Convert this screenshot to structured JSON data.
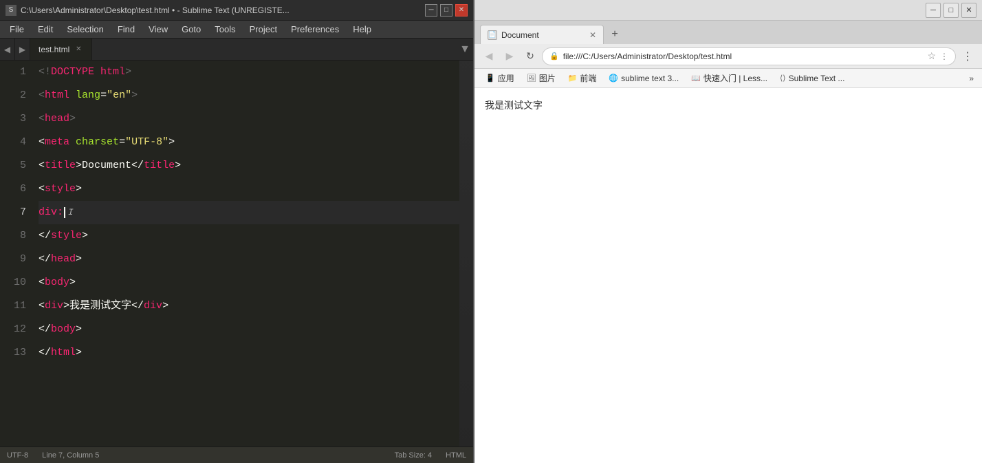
{
  "sublime": {
    "title_text": "C:\\Users\\Administrator\\Desktop\\test.html • - Sublime Text (UNREGISTE...",
    "tab_name": "test.html",
    "menu_items": [
      "File",
      "Edit",
      "Selection",
      "Find",
      "View",
      "Goto",
      "Tools",
      "Project",
      "Preferences",
      "Help"
    ],
    "status": {
      "encoding": "UTF-8",
      "position": "Line 7, Column 5",
      "tab_size": "Tab Size: 4",
      "syntax": "HTML"
    },
    "code_lines": [
      {
        "num": 1,
        "content": "<!DOCTYPE html>"
      },
      {
        "num": 2,
        "content": "<html lang=\"en\">"
      },
      {
        "num": 3,
        "content": "<head>"
      },
      {
        "num": 4,
        "content": "    <meta charset=\"UTF-8\">"
      },
      {
        "num": 5,
        "content": "    <title>Document</title>"
      },
      {
        "num": 6,
        "content": "    <style>"
      },
      {
        "num": 7,
        "content": "    div:"
      },
      {
        "num": 8,
        "content": "    </style>"
      },
      {
        "num": 9,
        "content": "    </head>"
      },
      {
        "num": 10,
        "content": "    <body>"
      },
      {
        "num": 11,
        "content": "    <div>我是测试文字</div>"
      },
      {
        "num": 12,
        "content": "    </body>"
      },
      {
        "num": 13,
        "content": "</html>"
      }
    ]
  },
  "browser": {
    "title": "Document",
    "url": "file:///C:/Users/Administrator/Desktop/test.html",
    "tab_label": "Document",
    "bookmarks": [
      {
        "icon": "📱",
        "label": "应用"
      },
      {
        "icon": "🖼",
        "label": "图片"
      },
      {
        "icon": "📁",
        "label": "前端"
      },
      {
        "icon": "🌐",
        "label": "sublime text 3..."
      },
      {
        "icon": "📖",
        "label": "快速入门 | Less..."
      },
      {
        "icon": "⟨⟩",
        "label": "Sublime Text ..."
      }
    ],
    "page_content": "我是测试文字"
  }
}
